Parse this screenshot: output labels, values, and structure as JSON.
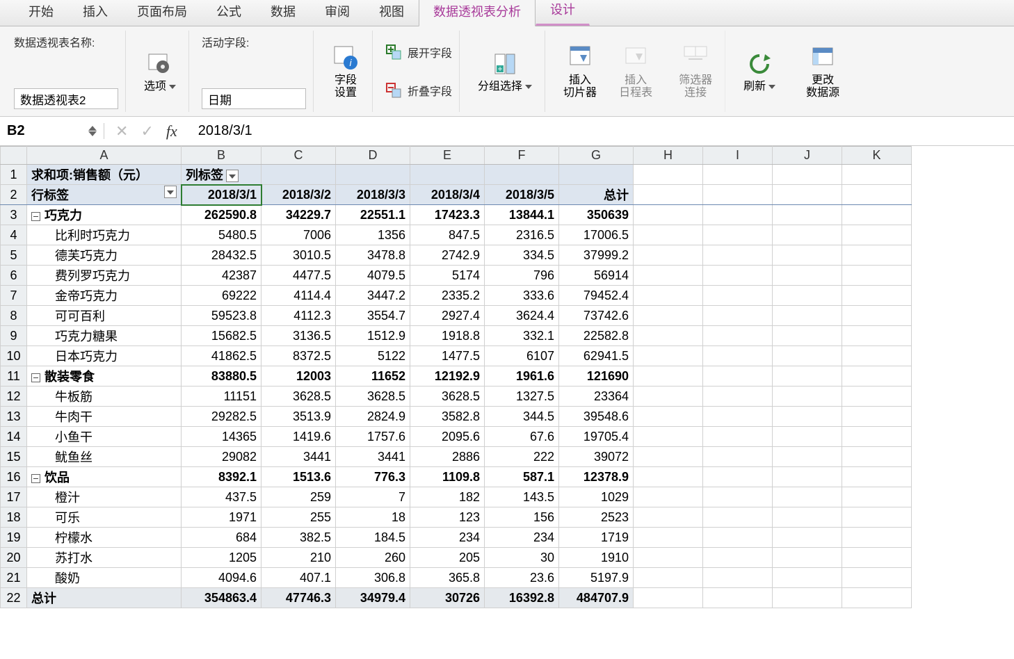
{
  "tabs": {
    "home": "开始",
    "insert": "插入",
    "layout": "页面布局",
    "formulas": "公式",
    "data": "数据",
    "review": "审阅",
    "view": "视图",
    "pivot_analyze": "数据透视表分析",
    "design": "设计"
  },
  "ribbon": {
    "pt_name_label": "数据透视表名称:",
    "pt_name_value": "数据透视表2",
    "options_label": "选项",
    "active_field_label": "活动字段:",
    "active_field_value": "日期",
    "field_settings": "字段\n设置",
    "expand_field": "展开字段",
    "collapse_field": "折叠字段",
    "group_select": "分组选择",
    "insert_slicer": "插入\n切片器",
    "insert_timeline": "插入\n日程表",
    "filter_conn": "筛选器\n连接",
    "refresh": "刷新",
    "change_source": "更改\n数据源"
  },
  "formula_bar": {
    "cell_ref": "B2",
    "value": "2018/3/1"
  },
  "columns": [
    "A",
    "B",
    "C",
    "D",
    "E",
    "F",
    "G",
    "H",
    "I",
    "J",
    "K"
  ],
  "pivot": {
    "value_field": "求和项:销售额（元）",
    "col_labels_label": "列标签",
    "row_labels_label": "行标签",
    "dates": [
      "2018/3/1",
      "2018/3/2",
      "2018/3/3",
      "2018/3/4",
      "2018/3/5"
    ],
    "grand_col": "总计",
    "categories": [
      {
        "name": "巧克力",
        "totals": [
          "262590.8",
          "34229.7",
          "22551.1",
          "17423.3",
          "13844.1",
          "350639"
        ],
        "items": [
          {
            "name": "比利时巧克力",
            "v": [
              "5480.5",
              "7006",
              "1356",
              "847.5",
              "2316.5",
              "17006.5"
            ]
          },
          {
            "name": "德芙巧克力",
            "v": [
              "28432.5",
              "3010.5",
              "3478.8",
              "2742.9",
              "334.5",
              "37999.2"
            ]
          },
          {
            "name": "费列罗巧克力",
            "v": [
              "42387",
              "4477.5",
              "4079.5",
              "5174",
              "796",
              "56914"
            ]
          },
          {
            "name": "金帝巧克力",
            "v": [
              "69222",
              "4114.4",
              "3447.2",
              "2335.2",
              "333.6",
              "79452.4"
            ]
          },
          {
            "name": "可可百利",
            "v": [
              "59523.8",
              "4112.3",
              "3554.7",
              "2927.4",
              "3624.4",
              "73742.6"
            ]
          },
          {
            "name": "巧克力糖果",
            "v": [
              "15682.5",
              "3136.5",
              "1512.9",
              "1918.8",
              "332.1",
              "22582.8"
            ]
          },
          {
            "name": "日本巧克力",
            "v": [
              "41862.5",
              "8372.5",
              "5122",
              "1477.5",
              "6107",
              "62941.5"
            ]
          }
        ]
      },
      {
        "name": "散装零食",
        "totals": [
          "83880.5",
          "12003",
          "11652",
          "12192.9",
          "1961.6",
          "121690"
        ],
        "items": [
          {
            "name": "牛板筋",
            "v": [
              "11151",
              "3628.5",
              "3628.5",
              "3628.5",
              "1327.5",
              "23364"
            ]
          },
          {
            "name": "牛肉干",
            "v": [
              "29282.5",
              "3513.9",
              "2824.9",
              "3582.8",
              "344.5",
              "39548.6"
            ]
          },
          {
            "name": "小鱼干",
            "v": [
              "14365",
              "1419.6",
              "1757.6",
              "2095.6",
              "67.6",
              "19705.4"
            ]
          },
          {
            "name": "鱿鱼丝",
            "v": [
              "29082",
              "3441",
              "3441",
              "2886",
              "222",
              "39072"
            ]
          }
        ]
      },
      {
        "name": "饮品",
        "totals": [
          "8392.1",
          "1513.6",
          "776.3",
          "1109.8",
          "587.1",
          "12378.9"
        ],
        "items": [
          {
            "name": "橙汁",
            "v": [
              "437.5",
              "259",
              "7",
              "182",
              "143.5",
              "1029"
            ]
          },
          {
            "name": "可乐",
            "v": [
              "1971",
              "255",
              "18",
              "123",
              "156",
              "2523"
            ]
          },
          {
            "name": "柠檬水",
            "v": [
              "684",
              "382.5",
              "184.5",
              "234",
              "234",
              "1719"
            ]
          },
          {
            "name": "苏打水",
            "v": [
              "1205",
              "210",
              "260",
              "205",
              "30",
              "1910"
            ]
          },
          {
            "name": "酸奶",
            "v": [
              "4094.6",
              "407.1",
              "306.8",
              "365.8",
              "23.6",
              "5197.9"
            ]
          }
        ]
      }
    ],
    "grand_row_label": "总计",
    "grand_totals": [
      "354863.4",
      "47746.3",
      "34979.4",
      "30726",
      "16392.8",
      "484707.9"
    ]
  }
}
